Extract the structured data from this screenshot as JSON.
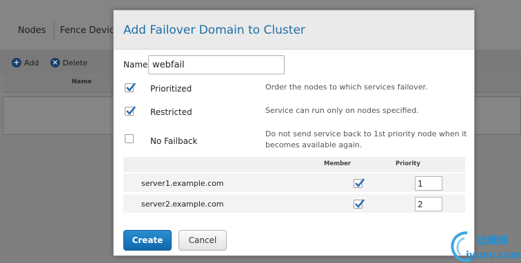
{
  "background": {
    "tabs": [
      "Nodes",
      "Fence Devic"
    ],
    "toolbar": {
      "add_label": "Add",
      "delete_label": "Delete"
    },
    "table_header": {
      "name": "Name"
    }
  },
  "dialog": {
    "title": "Add Failover Domain to Cluster",
    "name_label": "Name",
    "name_value": "webfail",
    "options": [
      {
        "label": "Prioritized",
        "checked": true,
        "description": "Order the nodes to which services failover."
      },
      {
        "label": "Restricted",
        "checked": true,
        "description": "Service can run only on nodes specified."
      },
      {
        "label": "No Failback",
        "checked": false,
        "description": "Do not send service back to 1st priority node when it becomes available again."
      }
    ],
    "members_header": {
      "member": "Member",
      "priority": "Priority"
    },
    "members": [
      {
        "server": "server1.example.com",
        "member": true,
        "priority": "1"
      },
      {
        "server": "server2.example.com",
        "member": true,
        "priority": "2"
      }
    ],
    "create_label": "Create",
    "cancel_label": "Cancel"
  },
  "watermark": {
    "text_cn": "运维网",
    "text_url": "iyunv.com"
  },
  "colors": {
    "accent": "#1d6fa8",
    "primary_button": "#1a7bc0",
    "overlay": "#808080"
  }
}
